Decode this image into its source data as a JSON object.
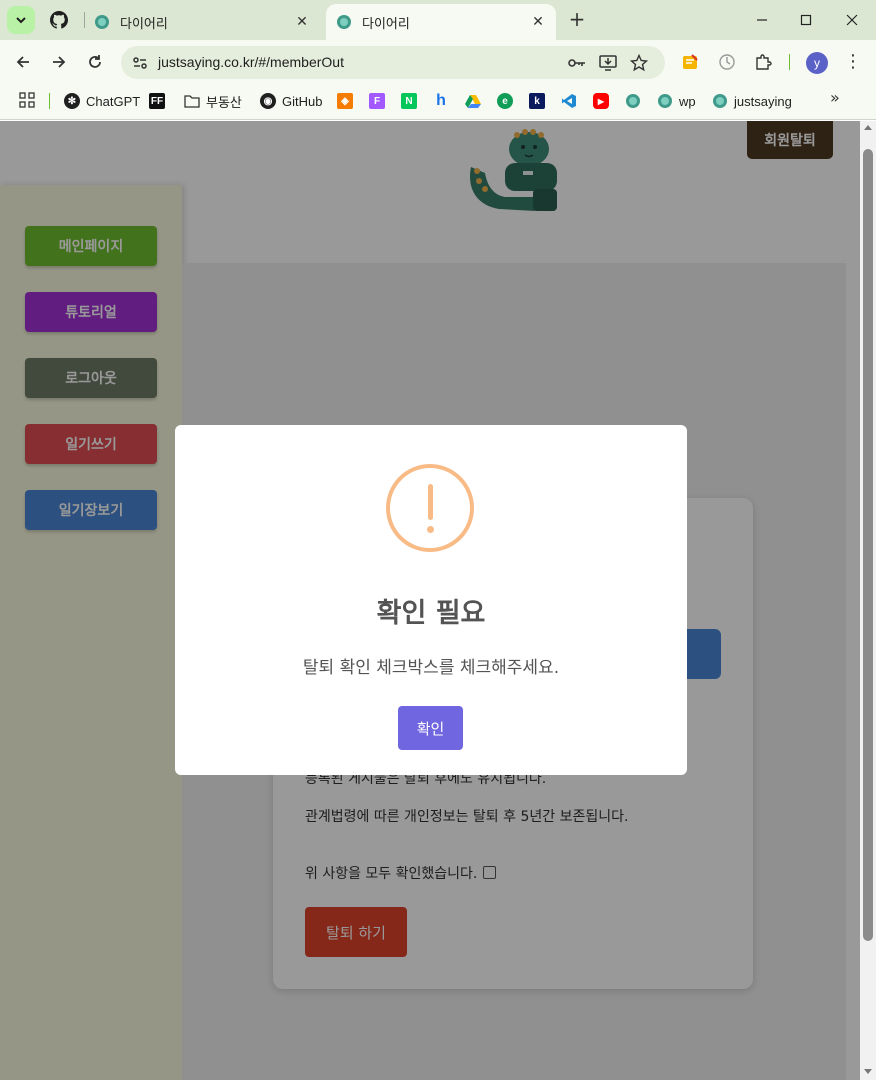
{
  "browser": {
    "tabs": [
      {
        "title": "다이어리",
        "active": false
      },
      {
        "title": "다이어리",
        "active": true
      }
    ],
    "url": "justsaying.co.kr/#/memberOut",
    "bookmarks": [
      {
        "label": "ChatGPT",
        "icon": "openai-icon"
      },
      {
        "label": "",
        "icon": "ff-icon"
      },
      {
        "label": "부동산",
        "icon": "folder-icon"
      },
      {
        "label": "GitHub",
        "icon": "github-icon"
      },
      {
        "label": "wp",
        "icon": "diary-favicon"
      },
      {
        "label": "justsaying",
        "icon": "diary-favicon"
      }
    ],
    "profile_initial": "y",
    "accent_color": "#dbe7d2"
  },
  "header": {
    "logout_label": "회원탈퇴"
  },
  "sidebar": {
    "items": [
      {
        "label": "메인페이지",
        "color": "#6fbe2e"
      },
      {
        "label": "튜토리얼",
        "color": "#a231d4"
      },
      {
        "label": "로그아웃",
        "color": "#6f7a66"
      },
      {
        "label": "일기쓰기",
        "color": "#e04e54"
      },
      {
        "label": "일기장보기",
        "color": "#4a86d4"
      }
    ]
  },
  "card": {
    "line1": "등록된 게시물은 탈퇴 후에도 유지됩니다.",
    "line2": "관계법령에 따른 개인정보는 탈퇴 후 5년간 보존됩니다.",
    "confirm_label": "위 사항을 모두 확인했습니다.",
    "withdraw_label": "탈퇴 하기"
  },
  "modal": {
    "title": "확인 필요",
    "text": "탈퇴 확인 체크박스를 체크해주세요.",
    "ok_label": "확인",
    "icon_color": "#f8bb86",
    "button_color": "#7066e0"
  }
}
